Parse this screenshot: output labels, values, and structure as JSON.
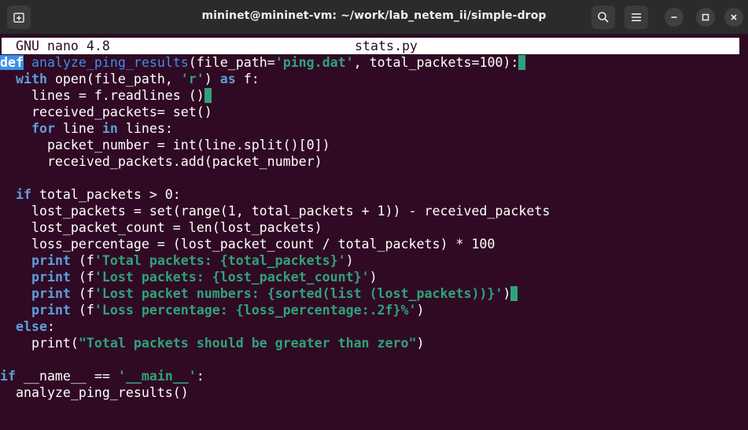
{
  "window": {
    "title": "mininet@mininet-vm: ~/work/lab_netem_ii/simple-drop"
  },
  "colors": {
    "terminal_bg": "#300a24",
    "titlebar_bg": "#2b2b2b",
    "keyword": "#5f9ed8",
    "string": "#2ea37b"
  },
  "icons": {
    "new_tab": "new-tab-icon",
    "search": "search-icon",
    "menu": "hamburger-menu-icon",
    "minimize": "minimize-icon",
    "maximize": "maximize-icon",
    "close": "close-icon"
  },
  "nano": {
    "version": "GNU nano 4.8",
    "filename": "stats.py"
  },
  "code": {
    "l1_def": "def",
    "l1_fn": "analyze_ping_results",
    "l1_a": "(file_path=",
    "l1_s1": "'ping.dat'",
    "l1_b": ", total_packets=100):",
    "l2_indent": "  ",
    "l2_with": "with",
    "l2_a": " open(file_path, ",
    "l2_s": "'r'",
    "l2_b": ") ",
    "l2_as": "as",
    "l2_c": " f:",
    "l3": "    lines = f.readlines ()",
    "l4": "    received_packets= set()",
    "l5_indent": "    ",
    "l5_for": "for",
    "l5_a": " line ",
    "l5_in": "in",
    "l5_b": " lines:",
    "l6": "      packet_number = int(line.split()[0])",
    "l7": "      received_packets.add(packet_number)",
    "l9_indent": "  ",
    "l9_if": "if",
    "l9_a": " total_packets > 0:",
    "l10": "    lost_packets = set(range(1, total_packets + 1)) - received_packets",
    "l11": "    lost_packet_count = len(lost_packets)",
    "l12": "    loss_percentage = (lost_packet_count / total_packets) * 100",
    "l13_indent": "    ",
    "l13_print": "print",
    "l13_a": " (f",
    "l13_s": "'Total packets: {total_packets}'",
    "l13_b": ")",
    "l14_print": "print",
    "l14_a": " (f",
    "l14_s": "'Lost packets: {lost_packet_count}'",
    "l14_b": ")",
    "l15_print": "print",
    "l15_a": " (f",
    "l15_s": "'Lost packet numbers: {sorted(list (lost_packets))}'",
    "l15_b": ")",
    "l16_print": "print",
    "l16_a": " (f",
    "l16_s": "'Loss percentage: {loss_percentage:.2f}%'",
    "l16_b": ")",
    "l17_else": "else",
    "l17_a": ":",
    "l18_a": "    print(",
    "l18_s": "\"Total packets should be greater than zero\"",
    "l18_b": ")",
    "l20_if": "if",
    "l20_a": " __name__ == ",
    "l20_s": "'__main__'",
    "l20_b": ":",
    "l21": "  analyze_ping_results()"
  }
}
